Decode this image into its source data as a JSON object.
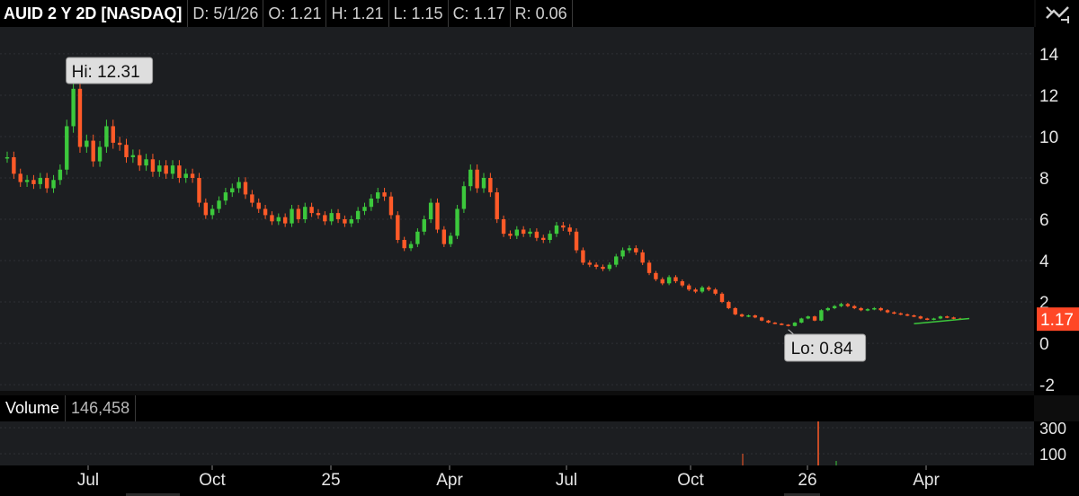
{
  "header": {
    "symbol": "AUID 2 Y 2D [NASDAQ]",
    "date": "D: 5/1/26",
    "open": "O: 1.21",
    "high": "H: 1.21",
    "low": "L: 1.15",
    "close": "C: 1.17",
    "range": "R: 0.06"
  },
  "volume_header": {
    "label": "Volume",
    "value": "146,458"
  },
  "colors": {
    "up": "#3cc83c",
    "down": "#ff5a28",
    "panel_bg": "#1c1e21",
    "price_tag": "#ff4726"
  },
  "chart_data": {
    "type": "candlestick",
    "y_ticks": [
      14,
      12,
      10,
      8,
      6,
      4,
      2,
      0,
      -2
    ],
    "y_range": [
      -2.3,
      15.3
    ],
    "x_tick_labels": [
      "Jul",
      "Oct",
      "25",
      "Apr",
      "Jul",
      "Oct",
      "26",
      "Apr"
    ],
    "last_price": "1.17",
    "high_label": "Hi: 12.31",
    "low_label": "Lo: 0.84",
    "volume_ticks": [
      "300",
      "100"
    ],
    "close_series": [
      9.0,
      8.2,
      7.8,
      7.9,
      7.7,
      8.0,
      7.5,
      7.9,
      8.4,
      10.5,
      12.31,
      9.5,
      9.8,
      8.8,
      9.5,
      10.5,
      9.7,
      9.6,
      9.0,
      9.1,
      8.6,
      8.9,
      8.3,
      8.6,
      8.2,
      8.6,
      8.0,
      8.2,
      8.0,
      6.8,
      6.2,
      6.5,
      6.9,
      7.3,
      7.5,
      7.8,
      7.2,
      6.8,
      6.5,
      6.2,
      5.9,
      6.1,
      5.8,
      6.5,
      6.0,
      6.6,
      6.3,
      6.2,
      5.9,
      6.3,
      6.0,
      5.8,
      6.0,
      6.4,
      6.6,
      7.0,
      7.3,
      7.1,
      6.2,
      5.0,
      4.6,
      4.8,
      5.4,
      6.0,
      6.8,
      5.5,
      4.8,
      5.2,
      6.5,
      7.6,
      8.4,
      7.5,
      8.0,
      7.3,
      6.0,
      5.3,
      5.2,
      5.5,
      5.3,
      5.4,
      5.1,
      5.0,
      5.3,
      5.7,
      5.6,
      5.4,
      4.5,
      3.9,
      3.8,
      3.7,
      3.6,
      3.8,
      4.2,
      4.5,
      4.6,
      4.4,
      3.9,
      3.4,
      3.1,
      2.9,
      3.2,
      3.0,
      2.8,
      2.6,
      2.5,
      2.7,
      2.6,
      2.4,
      2.0,
      1.7,
      1.4,
      1.3,
      1.35,
      1.25,
      1.1,
      1.0,
      0.95,
      0.9,
      0.84,
      1.0,
      1.2,
      1.3,
      1.1,
      1.6,
      1.7,
      1.8,
      1.9,
      1.8,
      1.7,
      1.6,
      1.65,
      1.7,
      1.6,
      1.5,
      1.45,
      1.4,
      1.35,
      1.3,
      1.2,
      1.15,
      1.2,
      1.3,
      1.25,
      1.2,
      1.17
    ]
  }
}
